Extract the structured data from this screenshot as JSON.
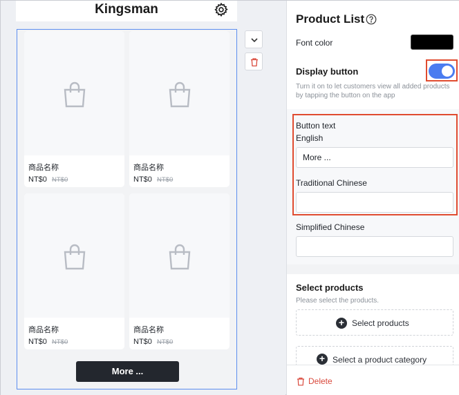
{
  "preview": {
    "store_name": "Kingsman",
    "products": [
      {
        "name": "商品名称",
        "price": "NT$0",
        "original_price": "NT$0"
      },
      {
        "name": "商品名称",
        "price": "NT$0",
        "original_price": "NT$0"
      },
      {
        "name": "商品名称",
        "price": "NT$0",
        "original_price": "NT$0"
      },
      {
        "name": "商品名称",
        "price": "NT$0",
        "original_price": "NT$0"
      }
    ],
    "more_button_label": "More ..."
  },
  "panel": {
    "title": "Product List",
    "font_color_label": "Font color",
    "font_color_value": "#000000",
    "display_button_label": "Display button",
    "display_button_enabled": true,
    "display_button_hint": "Turn it on to let customers view all added products by tapping the button on the app",
    "button_text_label": "Button text",
    "english_label": "English",
    "english_value": "More ...",
    "traditional_chinese_label": "Traditional Chinese",
    "traditional_chinese_value": "",
    "simplified_chinese_label": "Simplified Chinese",
    "simplified_chinese_value": "",
    "select_products_heading": "Select products",
    "select_products_hint": "Please select the products.",
    "select_products_button": "Select products",
    "select_category_button": "Select a product category",
    "delete_label": "Delete"
  },
  "colors": {
    "accent": "#4a7cf0",
    "highlight": "#e04b2f",
    "selection_border": "#5b8def",
    "danger": "#d9483b"
  }
}
